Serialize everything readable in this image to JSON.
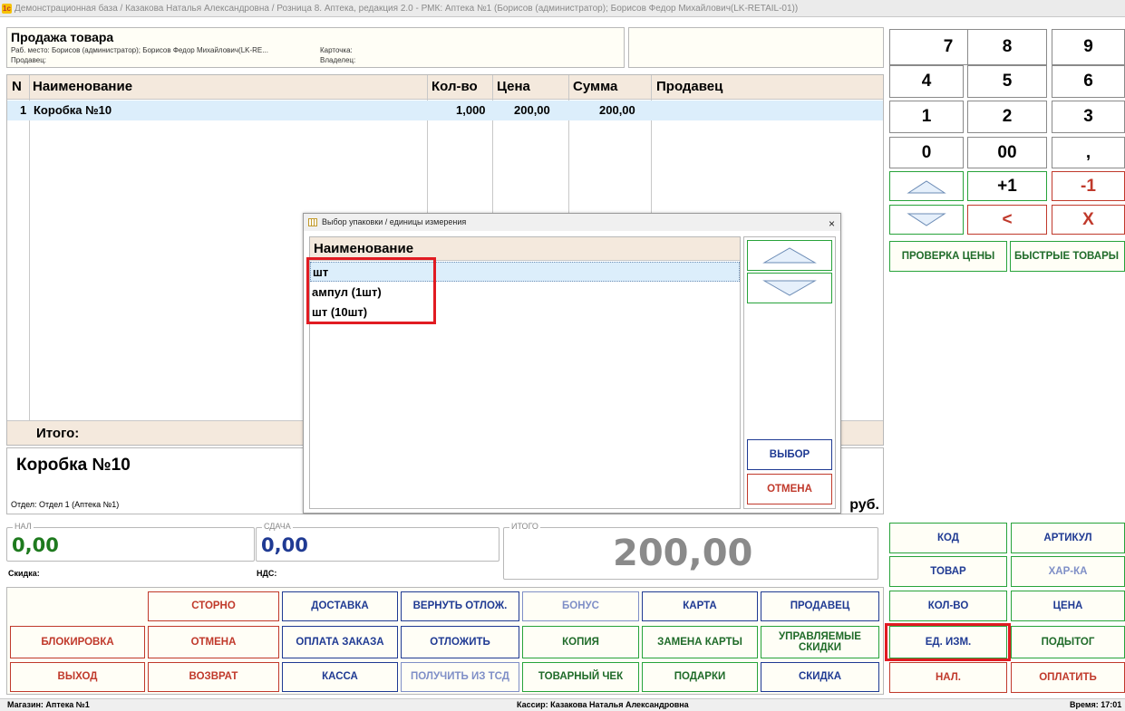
{
  "window": {
    "title": "Демонстрационная база / Казакова Наталья Александровна / Розница 8. Аптека, редакция 2.0 - РМК: Аптека №1 (Борисов (администратор); Борисов Федор Михайлович(LK-RETAIL-01))",
    "logo_text": "1с"
  },
  "header": {
    "title": "Продажа товара",
    "workplace": "Раб. место: Борисов (администратор); Борисов Федор Михайлович(LK-RE...",
    "card_label": "Карточка:",
    "seller_label": "Продавец:",
    "owner_label": "Владелец:"
  },
  "table": {
    "columns": [
      "N",
      "Наименование",
      "Кол-во",
      "Цена",
      "Сумма",
      "Продавец"
    ],
    "rows": [
      {
        "n": "1",
        "name": "Коробка №10",
        "qty": "1,000",
        "price": "200,00",
        "sum": "200,00",
        "seller": ""
      }
    ],
    "total_label": "Итого:"
  },
  "product": {
    "name": "Коробка №10",
    "department": "Отдел: Отдел 1 (Аптека №1)",
    "currency": "руб."
  },
  "summary": {
    "cash_legend": "НАЛ",
    "cash_value": "0,00",
    "change_legend": "СДАЧА",
    "change_value": "0,00",
    "total_legend": "ИТОГО",
    "total_value": "200,00",
    "discount_label": "Скидка:",
    "vat_label": "НДС:"
  },
  "bottom_buttons": {
    "storno": "СТОРНО",
    "delivery": "ДОСТАВКА",
    "return_deferred": "ВЕРНУТЬ ОТЛОЖ.",
    "bonus": "БОНУС",
    "card": "КАРТА",
    "seller": "ПРОДАВЕЦ",
    "block": "БЛОКИРОВКА",
    "cancel": "ОТМЕНА",
    "order_payment": "ОПЛАТА ЗАКАЗА",
    "defer": "ОТЛОЖИТЬ",
    "copy": "КОПИЯ",
    "replace_card": "ЗАМЕНА КАРТЫ",
    "managed_discounts": "УПРАВЛЯЕМЫЕ СКИДКИ",
    "exit": "ВЫХОД",
    "return": "ВОЗВРАТ",
    "cash_desk": "КАССА",
    "get_from_tsd": "ПОЛУЧИТЬ ИЗ ТСД",
    "sales_receipt": "ТОВАРНЫЙ ЧЕК",
    "gifts": "ПОДАРКИ",
    "discount": "СКИДКА"
  },
  "keypad": {
    "keys": [
      "7",
      "8",
      "9",
      "4",
      "5",
      "6",
      "1",
      "2",
      "3",
      "0",
      "00",
      ","
    ],
    "plus_one": "+1",
    "minus_one": "-1",
    "backspace": "<",
    "clear": "X",
    "price_check": "ПРОВЕРКА ЦЕНЫ",
    "quick_goods": "БЫСТРЫЕ ТОВАРЫ"
  },
  "right_buttons": {
    "code": "КОД",
    "article": "АРТИКУЛ",
    "goods": "ТОВАР",
    "characteristic": "ХАР-КА",
    "quantity": "КОЛ-ВО",
    "price": "ЦЕНА",
    "unit": "ЕД. ИЗМ.",
    "subtotal": "ПОДЫТОГ",
    "cash": "НАЛ.",
    "pay": "ОПЛАТИТЬ"
  },
  "dialog": {
    "title": "Выбор упаковки / единицы измерения",
    "close": "×",
    "column": "Наименование",
    "items": [
      "шт",
      "ампул (1шт)",
      "шт (10шт)"
    ],
    "select": "ВЫБОР",
    "cancel": "ОТМЕНА"
  },
  "status": {
    "store": "Магазин: Аптека №1",
    "cashier": "Кассир: Казакова Наталья Александровна",
    "time": "Время: 17:01"
  },
  "colors": {
    "header_bg": "#f4e9dd",
    "selection_bg": "#dceefb",
    "highlight": "#e11b22",
    "cash_green": "#1e7a1e",
    "change_blue": "#1f3a93",
    "total_gray": "#8a8a8a"
  }
}
